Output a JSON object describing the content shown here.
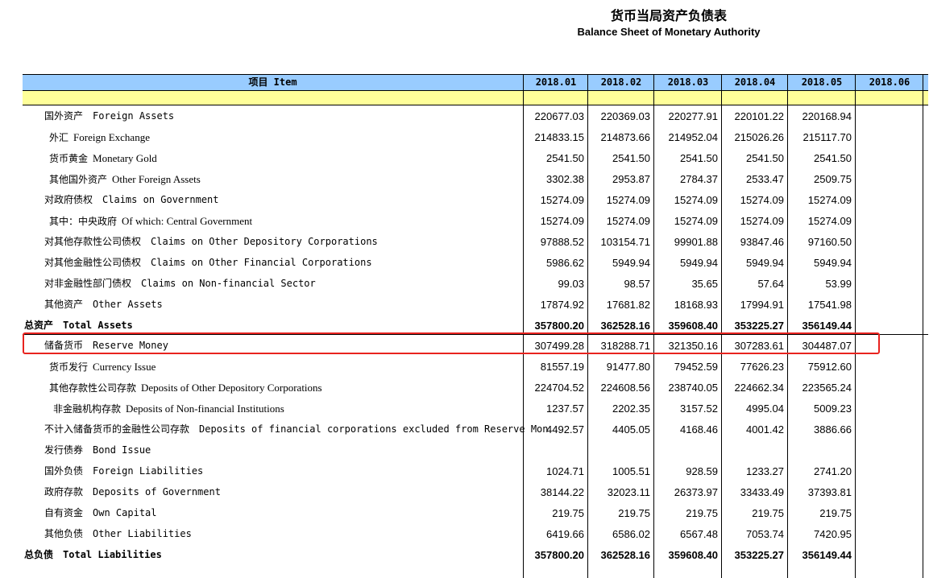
{
  "title": {
    "zh": "货币当局资产负债表",
    "en": "Balance Sheet of  Monetary Authority"
  },
  "header": {
    "item": "项目  Item",
    "columns": [
      "2018.01",
      "2018.02",
      "2018.03",
      "2018.04",
      "2018.05",
      "2018.06"
    ]
  },
  "rows": [
    {
      "zh": "国外资产",
      "en": "Foreign Assets",
      "en_style": "mono",
      "indent": 1,
      "bold": false,
      "values": [
        "220677.03",
        "220369.03",
        "220277.91",
        "220101.22",
        "220168.94",
        ""
      ]
    },
    {
      "zh": "外汇",
      "en": "Foreign Exchange",
      "en_style": "serif",
      "indent": 2,
      "bold": false,
      "values": [
        "214833.15",
        "214873.66",
        "214952.04",
        "215026.26",
        "215117.70",
        ""
      ]
    },
    {
      "zh": "货币黄金",
      "en": "Monetary Gold",
      "en_style": "serif",
      "indent": 2,
      "bold": false,
      "values": [
        "2541.50",
        "2541.50",
        "2541.50",
        "2541.50",
        "2541.50",
        ""
      ]
    },
    {
      "zh": "其他国外资产",
      "en": "Other Foreign Assets",
      "en_style": "serif",
      "indent": 2,
      "bold": false,
      "values": [
        "3302.38",
        "2953.87",
        "2784.37",
        "2533.47",
        "2509.75",
        ""
      ]
    },
    {
      "zh": "对政府债权",
      "en": "Claims on Government",
      "en_style": "mono",
      "indent": 1,
      "bold": false,
      "values": [
        "15274.09",
        "15274.09",
        "15274.09",
        "15274.09",
        "15274.09",
        ""
      ]
    },
    {
      "zh": "其中：中央政府",
      "en": "Of which: Central Government",
      "en_style": "serif",
      "indent": 2,
      "bold": false,
      "values": [
        "15274.09",
        "15274.09",
        "15274.09",
        "15274.09",
        "15274.09",
        ""
      ]
    },
    {
      "zh": "对其他存款性公司债权",
      "en": "Claims on Other Depository Corporations",
      "en_style": "mono",
      "indent": 1,
      "bold": false,
      "values": [
        "97888.52",
        "103154.71",
        "99901.88",
        "93847.46",
        "97160.50",
        ""
      ]
    },
    {
      "zh": "对其他金融性公司债权",
      "en": "Claims on Other Financial Corporations",
      "en_style": "mono",
      "indent": 1,
      "bold": false,
      "values": [
        "5986.62",
        "5949.94",
        "5949.94",
        "5949.94",
        "5949.94",
        ""
      ]
    },
    {
      "zh": "对非金融性部门债权",
      "en": "Claims on Non-financial Sector",
      "en_style": "mono",
      "indent": 1,
      "bold": false,
      "values": [
        "99.03",
        "98.57",
        "35.65",
        "57.64",
        "53.99",
        ""
      ]
    },
    {
      "zh": "其他资产",
      "en": "Other Assets",
      "en_style": "mono",
      "indent": 1,
      "bold": false,
      "values": [
        "17874.92",
        "17681.82",
        "18168.93",
        "17994.91",
        "17541.98",
        ""
      ]
    },
    {
      "zh": "总资产",
      "en": "Total Assets",
      "en_style": "mono",
      "indent": 0,
      "bold": true,
      "values": [
        "357800.20",
        "362528.16",
        "359608.40",
        "353225.27",
        "356149.44",
        ""
      ]
    },
    {
      "zh": "储备货币",
      "en": "Reserve Money",
      "en_style": "mono",
      "indent": 1,
      "bold": false,
      "values": [
        "307499.28",
        "318288.71",
        "321350.16",
        "307283.61",
        "304487.07",
        ""
      ]
    },
    {
      "zh": "货币发行",
      "en": "Currency Issue",
      "en_style": "serif",
      "indent": 2,
      "bold": false,
      "values": [
        "81557.19",
        "91477.80",
        "79452.59",
        "77626.23",
        "75912.60",
        ""
      ]
    },
    {
      "zh": "其他存款性公司存款",
      "en": "Deposits of Other Depository Corporations",
      "en_style": "serif",
      "indent": 2,
      "bold": false,
      "values": [
        "224704.52",
        "224608.56",
        "238740.05",
        "224662.34",
        "223565.24",
        ""
      ]
    },
    {
      "zh": "非金融机构存款",
      "en": "Deposits of Non-financial Institutions",
      "en_style": "serif",
      "indent": 3,
      "bold": false,
      "values": [
        "1237.57",
        "2202.35",
        "3157.52",
        "4995.04",
        "5009.23",
        ""
      ]
    },
    {
      "zh": "不计入储备货币的金融性公司存款",
      "en": "Deposits of financial corporations excluded from Reserve Money",
      "en_style": "mono",
      "indent": 1,
      "bold": false,
      "values": [
        "4492.57",
        "4405.05",
        "4168.46",
        "4001.42",
        "3886.66",
        ""
      ]
    },
    {
      "zh": "发行债券",
      "en": "Bond Issue",
      "en_style": "mono",
      "indent": 1,
      "bold": false,
      "values": [
        "",
        "",
        "",
        "",
        "",
        ""
      ]
    },
    {
      "zh": "国外负债",
      "en": "Foreign Liabilities",
      "en_style": "mono",
      "indent": 1,
      "bold": false,
      "values": [
        "1024.71",
        "1005.51",
        "928.59",
        "1233.27",
        "2741.20",
        ""
      ]
    },
    {
      "zh": "政府存款",
      "en": "Deposits of Government",
      "en_style": "mono",
      "indent": 1,
      "bold": false,
      "values": [
        "38144.22",
        "32023.11",
        "26373.97",
        "33433.49",
        "37393.81",
        ""
      ]
    },
    {
      "zh": "自有资金",
      "en": "Own Capital",
      "en_style": "mono",
      "indent": 1,
      "bold": false,
      "values": [
        "219.75",
        "219.75",
        "219.75",
        "219.75",
        "219.75",
        ""
      ]
    },
    {
      "zh": "其他负债",
      "en": "Other Liabilities",
      "en_style": "mono",
      "indent": 1,
      "bold": false,
      "values": [
        "6419.66",
        "6586.02",
        "6567.48",
        "7053.74",
        "7420.95",
        ""
      ]
    },
    {
      "zh": "总负债",
      "en": "Total  Liabilities",
      "en_style": "mono",
      "indent": 0,
      "bold": true,
      "values": [
        "357800.20",
        "362528.16",
        "359608.40",
        "353225.27",
        "356149.44",
        ""
      ]
    }
  ],
  "highlight": {
    "row_label": "储备货币",
    "color": "#e8231f"
  },
  "colors": {
    "header_bg": "#99ccff",
    "band_bg": "#ffff99",
    "highlight_border": "#e8231f"
  }
}
